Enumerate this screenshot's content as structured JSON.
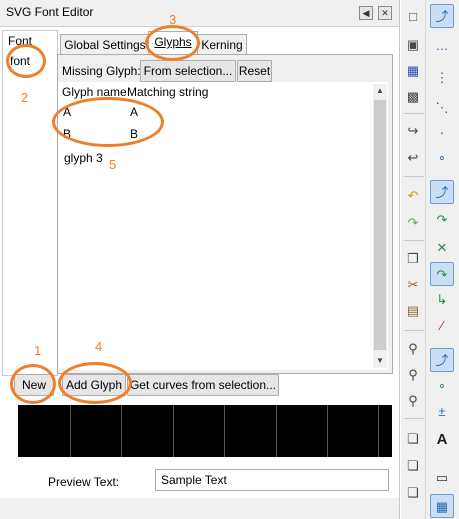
{
  "window": {
    "title": "SVG Font Editor",
    "pin_icon": "pin-icon",
    "close_icon": "close-icon"
  },
  "font_panel": {
    "header": "Font",
    "items": [
      "font"
    ],
    "new_button": "New"
  },
  "tabs": {
    "global": "Global Settings",
    "glyphs": "Glyphs",
    "kerning": "Kerning",
    "active": "Glyphs"
  },
  "glyphs_tab": {
    "missing_glyph_label": "Missing Glyph:",
    "from_selection_button": "From selection...",
    "reset_button": "Reset",
    "columns": [
      "Glyph name",
      "Matching string"
    ],
    "rows": [
      {
        "name": "A",
        "match": "A"
      },
      {
        "name": "B",
        "match": "B"
      },
      {
        "name": "glyph 3",
        "match": ""
      }
    ],
    "add_glyph_button": "Add Glyph",
    "get_curves_button": "Get curves from selection..."
  },
  "preview": {
    "label": "Preview Text:",
    "value": "Sample Text"
  },
  "annotations": {
    "color": "#f07f2b",
    "numbers": [
      "1",
      "2",
      "3",
      "4",
      "5"
    ]
  },
  "toolbar_left": {
    "icons": [
      "new-document-icon",
      "open-folder-icon",
      "save-icon",
      "print-icon",
      "import-icon",
      "export-icon",
      "undo-icon",
      "redo-icon",
      "copy-icon",
      "cut-icon",
      "paste-icon",
      "zoom-selection-icon",
      "zoom-drawing-icon",
      "zoom-page-icon",
      "duplicate-icon",
      "clone-icon",
      "unlink-clone-icon"
    ]
  },
  "toolbar_right": {
    "icons": [
      "snap-toggle-icon",
      "snap-bbox-icon",
      "snap-bbox-edge-icon",
      "snap-bbox-corner-icon",
      "snap-bbox-midpoint-icon",
      "snap-nodes-icon",
      "snap-path-icon",
      "snap-intersection-icon",
      "snap-cusp-icon",
      "snap-smooth-icon",
      "snap-midpoint-icon",
      "snap-others-icon",
      "snap-center-icon",
      "snap-rotation-icon",
      "snap-text-baseline-icon",
      "snap-page-border-icon",
      "snap-grid-icon"
    ],
    "accent": "#2a6aa8"
  }
}
